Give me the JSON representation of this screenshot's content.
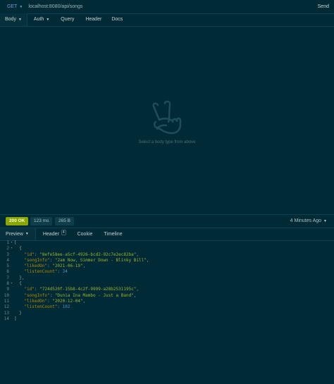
{
  "request": {
    "method": "GET",
    "url": "localhost:8080/api/songs",
    "send_label": "Send"
  },
  "request_tabs": [
    {
      "label": "Body",
      "dropdown": true
    },
    {
      "label": "Auth",
      "dropdown": true
    },
    {
      "label": "Query"
    },
    {
      "label": "Header"
    },
    {
      "label": "Docs"
    }
  ],
  "empty_state": {
    "hint": "Select a body type from above",
    "icon": "peace-hand-icon"
  },
  "response": {
    "status": "200 OK",
    "time": "123 ms",
    "size": "265 B",
    "ago": "4 Minutes Ago",
    "tabs": {
      "preview": "Preview",
      "header": "Header",
      "header_count": "4",
      "cookie": "Cookie",
      "timeline": "Timeline"
    },
    "lines": [
      {
        "n": "1",
        "fold": "▾",
        "text": "["
      },
      {
        "n": "2",
        "fold": "▾",
        "text": "  {"
      },
      {
        "n": "3",
        "fold": "",
        "key": "\"id\"",
        "val": "\"8efe58ee-a5cf-4926-bcd2-92c7e2ec82ba\"",
        "type": "s",
        "end": ","
      },
      {
        "n": "4",
        "fold": "",
        "key": "\"songInfo\"",
        "val": "\"Jam Now, Simmer Down - Blinky Bill\"",
        "type": "s",
        "end": ","
      },
      {
        "n": "5",
        "fold": "",
        "key": "\"likedOn\"",
        "val": "\"2021-06-19\"",
        "type": "s",
        "end": ","
      },
      {
        "n": "6",
        "fold": "",
        "key": "\"listenCount\"",
        "val": "34",
        "type": "n",
        "end": ""
      },
      {
        "n": "7",
        "fold": "",
        "text": "  },"
      },
      {
        "n": "8",
        "fold": "▾",
        "text": "  {"
      },
      {
        "n": "9",
        "fold": "",
        "key": "\"id\"",
        "val": "\"724d520f-15b8-4c2f-9999-a28b2531195c\"",
        "type": "s",
        "end": ","
      },
      {
        "n": "10",
        "fold": "",
        "key": "\"songInfo\"",
        "val": "\"Dunia Ina Mambo - Just a Band\"",
        "type": "s",
        "end": ","
      },
      {
        "n": "11",
        "fold": "",
        "key": "\"likedOn\"",
        "val": "\"2020-12-04\"",
        "type": "s",
        "end": ","
      },
      {
        "n": "12",
        "fold": "",
        "key": "\"listenCount\"",
        "val": "102",
        "type": "n",
        "end": ""
      },
      {
        "n": "13",
        "fold": "",
        "text": "  }"
      },
      {
        "n": "14",
        "fold": "",
        "text": "]"
      }
    ]
  },
  "colors": {
    "background": "#002b36",
    "status_ok": "#8aa600",
    "string": "#9bb22c",
    "key": "#b58900",
    "number": "#4a90c2"
  }
}
